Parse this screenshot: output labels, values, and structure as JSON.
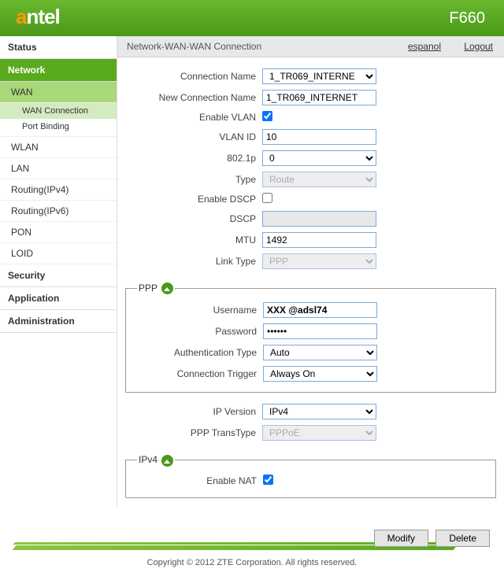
{
  "header": {
    "model": "F660"
  },
  "titlebar": {
    "path": "Network-WAN-WAN Connection",
    "lang": "espanol",
    "logout": "Logout"
  },
  "sidebar": {
    "status": "Status",
    "network": "Network",
    "wan": "WAN",
    "wan_conn": "WAN Connection",
    "port_binding": "Port Binding",
    "wlan": "WLAN",
    "lan": "LAN",
    "routing4": "Routing(IPv4)",
    "routing6": "Routing(IPv6)",
    "pon": "PON",
    "loid": "LOID",
    "security": "Security",
    "application": "Application",
    "administration": "Administration"
  },
  "form": {
    "conn_name_lbl": "Connection Name",
    "conn_name_val": "1_TR069_INTERNE",
    "new_conn_lbl": "New Connection Name",
    "new_conn_val": "1_TR069_INTERNET",
    "enable_vlan_lbl": "Enable VLAN",
    "vlan_id_lbl": "VLAN ID",
    "vlan_id_val": "10",
    "p8021_lbl": "802.1p",
    "p8021_val": "0",
    "type_lbl": "Type",
    "type_val": "Route",
    "enable_dscp_lbl": "Enable DSCP",
    "dscp_lbl": "DSCP",
    "dscp_val": "",
    "mtu_lbl": "MTU",
    "mtu_val": "1492",
    "link_type_lbl": "Link Type",
    "link_type_val": "PPP",
    "ppp_legend": "PPP",
    "username_lbl": "Username",
    "username_val": "XXX @adsl74",
    "password_lbl": "Password",
    "password_val": "••••••",
    "auth_lbl": "Authentication Type",
    "auth_val": "Auto",
    "trigger_lbl": "Connection Trigger",
    "trigger_val": "Always On",
    "ipver_lbl": "IP Version",
    "ipver_val": "IPv4",
    "trans_lbl": "PPP TransType",
    "trans_val": "PPPoE",
    "ipv4_legend": "IPv4",
    "nat_lbl": "Enable NAT"
  },
  "buttons": {
    "modify": "Modify",
    "delete": "Delete"
  },
  "footer": "Copyright © 2012 ZTE Corporation. All rights reserved."
}
